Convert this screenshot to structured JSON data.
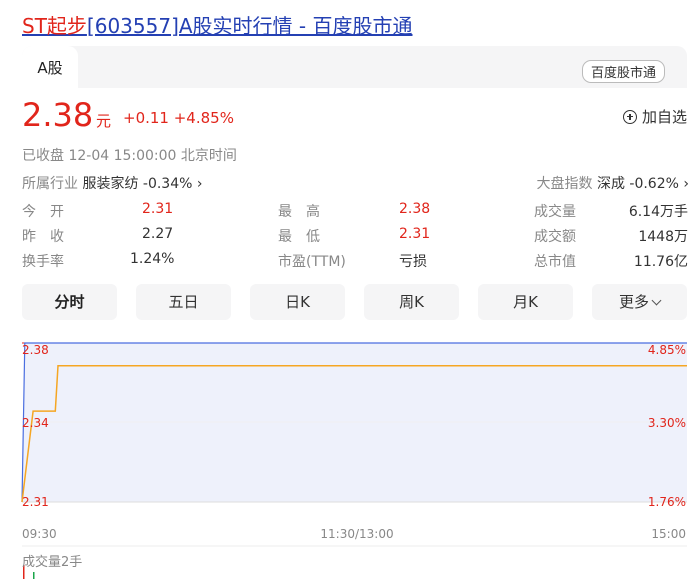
{
  "page": {
    "title_highlight": "ST起步",
    "title_rest": "[603557]A股实时行情 - 百度股市通"
  },
  "tabs": {
    "market_tab": "A股",
    "source_badge": "百度股市通"
  },
  "quote": {
    "price": "2.38",
    "unit": "元",
    "change": "+0.11 +4.85%",
    "add_watchlist": "加自选",
    "status": "已收盘  12-04 15:00:00  北京时间",
    "industry_label": "所属行业",
    "industry_value": "服装家纺 -0.34%",
    "index_label": "大盘指数",
    "index_value": "深成 -0.62%"
  },
  "stats": {
    "open_label": "今　开",
    "open_value": "2.31",
    "prev_close_label": "昨　收",
    "prev_close_value": "2.27",
    "turnover_label": "换手率",
    "turnover_value": "1.24%",
    "high_label": "最　高",
    "high_value": "2.38",
    "low_label": "最　低",
    "low_value": "2.31",
    "pe_label": "市盈(TTM)",
    "pe_value": "亏损",
    "volume_label": "成交量",
    "volume_value": "6.14万手",
    "amount_label": "成交额",
    "amount_value": "1448万",
    "mktcap_label": "总市值",
    "mktcap_value": "11.76亿"
  },
  "period_tabs": [
    "分时",
    "五日",
    "日K",
    "周K",
    "月K",
    "更多"
  ],
  "colors": {
    "up": "#e1251b",
    "price_line": "#f5a623",
    "area_fill": "#eef1fb",
    "title_link": "#2440b3",
    "volume_bar": "#1aa64a"
  },
  "chart_data": {
    "type": "line",
    "price_labels": [
      "2.38",
      "2.34",
      "2.31"
    ],
    "pct_labels": [
      "4.85%",
      "3.30%",
      "1.76%"
    ],
    "time_labels": [
      "09:30",
      "11:30/13:00",
      "15:00"
    ],
    "y_range": [
      2.31,
      2.38
    ],
    "series": [
      {
        "values": [
          {
            "t": 0,
            "y": 2.31
          },
          {
            "t": 3,
            "y": 2.34
          },
          {
            "t": 4,
            "y": 2.35
          },
          {
            "t": 12,
            "y": 2.35
          },
          {
            "t": 13,
            "y": 2.37
          },
          {
            "t": 40,
            "y": 2.37
          },
          {
            "t": 240,
            "y": 2.37
          }
        ]
      }
    ],
    "avg_line": [
      {
        "t": 0,
        "y": 2.31
      },
      {
        "t": 1,
        "y": 2.38
      },
      {
        "t": 240,
        "y": 2.38
      }
    ],
    "volume_label": "成交量2手",
    "volume_bars": [
      2,
      1
    ]
  }
}
